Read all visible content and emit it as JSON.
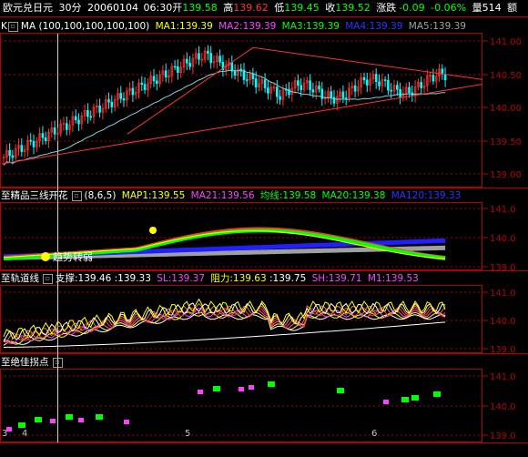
{
  "top": {
    "instrument": "欧元兑日元",
    "period": "30分",
    "date": "20060104",
    "time": "06:30",
    "open_label": "开",
    "open": "139.58",
    "high_label": "高",
    "high": "139.62",
    "low_label": "低",
    "low": "139.45",
    "close_label": "收",
    "close": "139.52",
    "chg_label": "涨跌",
    "chg": "-0.09",
    "chg_pct": "-0.06%",
    "vol_label": "量",
    "vol": "514",
    "amt_label": "额"
  },
  "panel1": {
    "k_label": "K",
    "ma_label": "MA",
    "params": "(100,100,100,100,100)",
    "ma1": "MA1:139.39",
    "ma2": "MA2:139.39",
    "ma3": "MA3:139.39",
    "ma4": "MA4:139.39",
    "ma5": "MA5:139.39",
    "ticks": [
      "141.00",
      "140.50",
      "140.00",
      "139.50",
      "139.00"
    ]
  },
  "panel2": {
    "title": "至精品三线开花",
    "params": "(8,6,5)",
    "map1": "MAP1:139.55",
    "ma21": "MA21:139.56",
    "avg": "均线:139.58",
    "ma20": "MA20:139.38",
    "ma120": "MA120:139.33",
    "note": "趋势转弱",
    "ticks": [
      "141.0",
      "140.0",
      "139.0"
    ]
  },
  "panel3": {
    "title": "至轨道线",
    "support": "支撑:139.46",
    "support2": ":139.33",
    "sl": "SL:139.37",
    "resist": "阻力:139.63",
    "resist2": ":139.75",
    "sh": "SH:139.71",
    "m1": "M1:139.53",
    "ticks": [
      "141.0",
      "140.0",
      "139.0"
    ]
  },
  "panel4": {
    "title": "至绝佳拐点",
    "ticks": [
      "141.0",
      "140.0",
      "139.0"
    ]
  },
  "xaxis": {
    "labels": [
      "3",
      "4",
      "5",
      "6"
    ]
  },
  "colors": {
    "up": "#ff3030",
    "down": "#00ffff",
    "yellow": "#ffff00",
    "magenta": "#ff40ff",
    "green": "#00ff00",
    "blue": "#2020ff",
    "gray": "#a0a0a0",
    "frame": "#b00000"
  }
}
